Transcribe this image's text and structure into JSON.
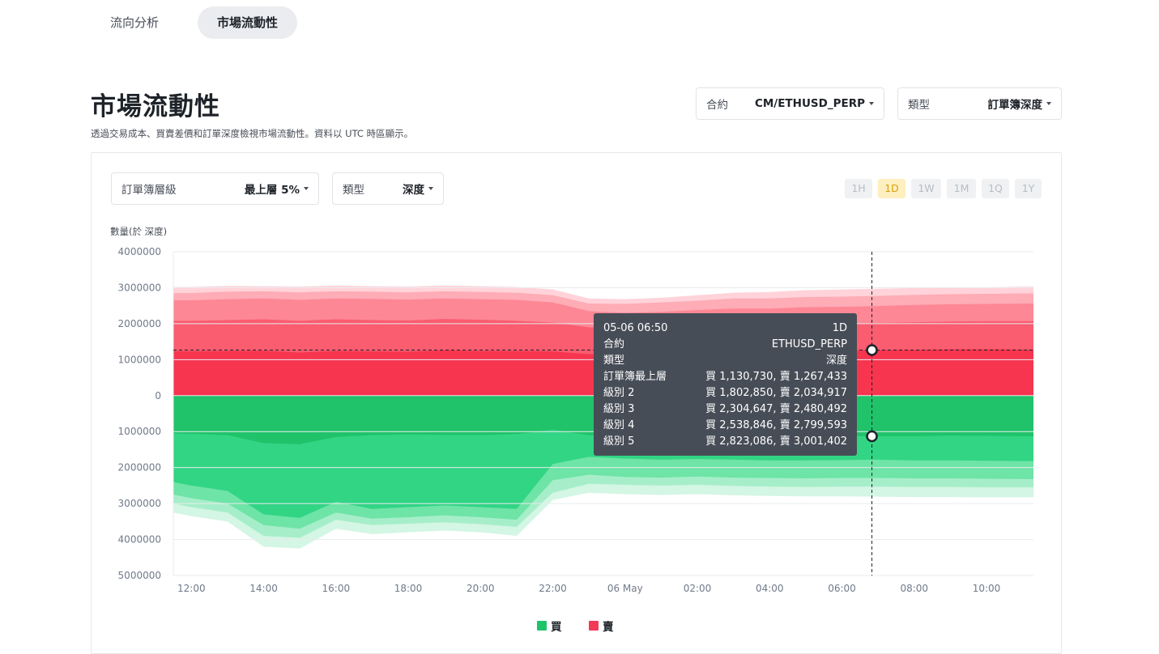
{
  "tabs": [
    {
      "label": "流向分析",
      "active": false
    },
    {
      "label": "市場流動性",
      "active": true
    }
  ],
  "page": {
    "title": "市場流動性",
    "description": "透過交易成本、買賣差價和訂單深度檢視市場流動性。資料以 UTC 時區顯示。"
  },
  "filters": {
    "contract": {
      "label": "合約",
      "value": "CM/ETHUSD_PERP"
    },
    "type": {
      "label": "類型",
      "value": "訂單簿深度"
    },
    "book_level": {
      "label": "訂單簿層級",
      "value": "最上層 5%"
    },
    "chart_type": {
      "label": "類型",
      "value": "深度"
    }
  },
  "time_ranges": [
    {
      "label": "1H",
      "active": false
    },
    {
      "label": "1D",
      "active": true
    },
    {
      "label": "1W",
      "active": false
    },
    {
      "label": "1M",
      "active": false
    },
    {
      "label": "1Q",
      "active": false
    },
    {
      "label": "1Y",
      "active": false
    }
  ],
  "tooltip": {
    "time": "05-06 06:50",
    "range": "1D",
    "rows": [
      {
        "label": "合約",
        "value": "ETHUSD_PERP"
      },
      {
        "label": "類型",
        "value": "深度"
      },
      {
        "label": "訂單簿最上層",
        "value": "買 1,130,730, 賣 1,267,433"
      },
      {
        "label": "級別 2",
        "value": "買 1,802,850, 賣 2,034,917"
      },
      {
        "label": "級別 3",
        "value": "買 2,304,647, 賣 2,480,492"
      },
      {
        "label": "級別 4",
        "value": "買 2,538,846, 賣 2,799,593"
      },
      {
        "label": "級別 5",
        "value": "買 2,823,086, 賣 3,001,402"
      }
    ]
  },
  "legend": [
    {
      "label": "買",
      "color": "#20c36a"
    },
    {
      "label": "賣",
      "color": "#f23a57"
    }
  ],
  "chart_data": {
    "type": "area",
    "ylabel": "數量(於 深度)",
    "y_tick_labels": [
      "4000000",
      "3000000",
      "2000000",
      "1000000",
      "0",
      "1000000",
      "2000000",
      "3000000",
      "4000000",
      "5000000"
    ],
    "ylim": [
      -5000000,
      4000000
    ],
    "x_tick_labels": [
      "12:00",
      "14:00",
      "16:00",
      "18:00",
      "20:00",
      "22:00",
      "06 May",
      "02:00",
      "04:00",
      "06:00",
      "08:00",
      "10:00"
    ],
    "x_hours": [
      11.5,
      12,
      13,
      14,
      15,
      16,
      17,
      18,
      19,
      20,
      21,
      22,
      23,
      24,
      25,
      26,
      27,
      28,
      29,
      30,
      31,
      32,
      33,
      34,
      35,
      35.3
    ],
    "sell_series": [
      {
        "name": "賣 級別 1",
        "color": "#f7354f",
        "values": [
          1240000,
          1230000,
          1240000,
          1250000,
          1200000,
          1240000,
          1230000,
          1220000,
          1260000,
          1240000,
          1240000,
          1230000,
          1150000,
          1170000,
          1200000,
          1230000,
          1250000,
          1240000,
          1260000,
          1260000,
          1270000,
          1270000,
          1290000,
          1290000,
          1280000,
          1280000
        ]
      },
      {
        "name": "賣 級別 2",
        "color": "#fa5c70",
        "values": [
          2080000,
          2080000,
          2100000,
          2120000,
          2080000,
          2120000,
          2100000,
          2090000,
          2130000,
          2110000,
          2080000,
          2030000,
          1900000,
          1850000,
          1880000,
          1920000,
          1960000,
          1960000,
          1990000,
          2000000,
          2020000,
          2040000,
          2060000,
          2070000,
          2070000,
          2070000
        ]
      },
      {
        "name": "賣 級別 3",
        "color": "#fd8795",
        "values": [
          2650000,
          2650000,
          2680000,
          2700000,
          2660000,
          2700000,
          2690000,
          2670000,
          2700000,
          2680000,
          2660000,
          2590000,
          2350000,
          2300000,
          2330000,
          2380000,
          2420000,
          2420000,
          2460000,
          2470000,
          2490000,
          2520000,
          2540000,
          2550000,
          2560000,
          2560000
        ]
      },
      {
        "name": "賣 級別 4",
        "color": "#feacb6",
        "values": [
          2850000,
          2850000,
          2890000,
          2900000,
          2870000,
          2900000,
          2890000,
          2870000,
          2900000,
          2880000,
          2860000,
          2790000,
          2560000,
          2550000,
          2590000,
          2640000,
          2700000,
          2700000,
          2740000,
          2750000,
          2770000,
          2800000,
          2820000,
          2830000,
          2840000,
          2840000
        ]
      },
      {
        "name": "賣 級別 5",
        "color": "#ffd3d9",
        "values": [
          3020000,
          3020000,
          3050000,
          3040000,
          3030000,
          3060000,
          3040000,
          3030000,
          3060000,
          3040000,
          3020000,
          2950000,
          2700000,
          2680000,
          2720000,
          2790000,
          2860000,
          2880000,
          2930000,
          2950000,
          2970000,
          2990000,
          3010000,
          3010000,
          3030000,
          3030000
        ]
      }
    ],
    "buy_series": [
      {
        "name": "買 級別 1",
        "color": "#20c36a",
        "values": [
          -1050000,
          -1060000,
          -1100000,
          -1320000,
          -1350000,
          -1150000,
          -1100000,
          -1080000,
          -1090000,
          -1100000,
          -1070000,
          -950000,
          -1100000,
          -1120000,
          -1130000,
          -1120000,
          -1150000,
          -1160000,
          -1140000,
          -1130000,
          -1130000,
          -1130000,
          -1110000,
          -1120000,
          -1130000,
          -1130000
        ]
      },
      {
        "name": "買 級別 2",
        "color": "#31d584",
        "values": [
          -2400000,
          -2500000,
          -2650000,
          -3300000,
          -3400000,
          -2950000,
          -3150000,
          -3100000,
          -3050000,
          -3100000,
          -3150000,
          -1900000,
          -1700000,
          -1750000,
          -1780000,
          -1760000,
          -1780000,
          -1800000,
          -1800000,
          -1790000,
          -1780000,
          -1800000,
          -1800000,
          -1810000,
          -1820000,
          -1820000
        ]
      },
      {
        "name": "買 級別 3",
        "color": "#6ee4a6",
        "values": [
          -2750000,
          -2850000,
          -3000000,
          -3600000,
          -3700000,
          -3250000,
          -3420000,
          -3380000,
          -3330000,
          -3380000,
          -3450000,
          -2350000,
          -2200000,
          -2260000,
          -2280000,
          -2250000,
          -2280000,
          -2290000,
          -2300000,
          -2290000,
          -2290000,
          -2300000,
          -2300000,
          -2310000,
          -2320000,
          -2320000
        ]
      },
      {
        "name": "買 級別 4",
        "color": "#a6eec9",
        "values": [
          -3000000,
          -3100000,
          -3250000,
          -3900000,
          -3950000,
          -3450000,
          -3600000,
          -3560000,
          -3520000,
          -3570000,
          -3650000,
          -2700000,
          -2450000,
          -2480000,
          -2500000,
          -2480000,
          -2510000,
          -2530000,
          -2540000,
          -2530000,
          -2530000,
          -2540000,
          -2540000,
          -2550000,
          -2550000,
          -2550000
        ]
      },
      {
        "name": "買 級別 5",
        "color": "#d4f6e4",
        "values": [
          -3250000,
          -3350000,
          -3500000,
          -4200000,
          -4250000,
          -3700000,
          -3850000,
          -3800000,
          -3750000,
          -3800000,
          -3900000,
          -2900000,
          -2700000,
          -2740000,
          -2760000,
          -2740000,
          -2770000,
          -2790000,
          -2800000,
          -2800000,
          -2810000,
          -2820000,
          -2820000,
          -2830000,
          -2830000,
          -2830000
        ]
      }
    ],
    "crosshair": {
      "x_hour": 30.83,
      "sell_y": 1267433,
      "buy_y": -1130730
    },
    "grid": true
  }
}
